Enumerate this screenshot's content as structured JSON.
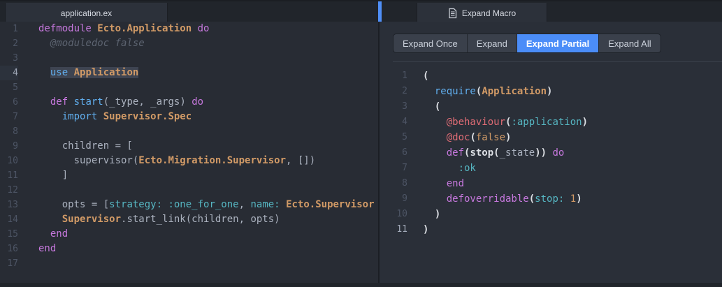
{
  "colors": {
    "accent_blue": "#4b8df8",
    "pane_accent_bar": "#4f8ff7",
    "selection": "#3e4451",
    "editor_bg": "#282c34",
    "tabbar_bg": "#21252b"
  },
  "icons": {
    "right_tab_icon": "file-text-icon"
  },
  "left_pane": {
    "tab": "application.ex",
    "lines": [
      {
        "n": 1,
        "tokens": [
          {
            "t": "defmodule",
            "c": "kw"
          },
          {
            "t": " ",
            "c": "pl"
          },
          {
            "t": "Ecto.Application",
            "c": "mod"
          },
          {
            "t": " ",
            "c": "pl"
          },
          {
            "t": "do",
            "c": "kw"
          }
        ]
      },
      {
        "n": 2,
        "tokens": [
          {
            "t": "  @moduledoc false",
            "c": "com"
          }
        ]
      },
      {
        "n": 3,
        "tokens": []
      },
      {
        "n": 4,
        "hl": true,
        "tokens": [
          {
            "t": "  ",
            "c": "pl"
          },
          {
            "t": "use",
            "c": "blue",
            "sel": true
          },
          {
            "t": " ",
            "c": "pl",
            "sel": true
          },
          {
            "t": "Application",
            "c": "mod",
            "sel": true
          }
        ]
      },
      {
        "n": 5,
        "tokens": []
      },
      {
        "n": 6,
        "tokens": [
          {
            "t": "  ",
            "c": "pl"
          },
          {
            "t": "def",
            "c": "kw"
          },
          {
            "t": " ",
            "c": "pl"
          },
          {
            "t": "start",
            "c": "blue"
          },
          {
            "t": "(_type, _args) ",
            "c": "pl"
          },
          {
            "t": "do",
            "c": "kw"
          }
        ]
      },
      {
        "n": 7,
        "tokens": [
          {
            "t": "    ",
            "c": "pl"
          },
          {
            "t": "import",
            "c": "blue"
          },
          {
            "t": " ",
            "c": "pl"
          },
          {
            "t": "Supervisor.Spec",
            "c": "mod"
          }
        ]
      },
      {
        "n": 8,
        "tokens": []
      },
      {
        "n": 9,
        "tokens": [
          {
            "t": "    children = [",
            "c": "pl"
          }
        ]
      },
      {
        "n": 10,
        "tokens": [
          {
            "t": "      supervisor(",
            "c": "pl"
          },
          {
            "t": "Ecto.Migration.Supervisor",
            "c": "mod"
          },
          {
            "t": ", [])",
            "c": "pl"
          }
        ]
      },
      {
        "n": 11,
        "tokens": [
          {
            "t": "    ]",
            "c": "pl"
          }
        ]
      },
      {
        "n": 12,
        "tokens": []
      },
      {
        "n": 13,
        "tokens": [
          {
            "t": "    opts = [",
            "c": "pl"
          },
          {
            "t": "strategy:",
            "c": "atom"
          },
          {
            "t": " ",
            "c": "pl"
          },
          {
            "t": ":one_for_one",
            "c": "atom"
          },
          {
            "t": ", ",
            "c": "pl"
          },
          {
            "t": "name:",
            "c": "atom"
          },
          {
            "t": " ",
            "c": "pl"
          },
          {
            "t": "Ecto.Supervisor",
            "c": "mod"
          }
        ]
      },
      {
        "n": 14,
        "tokens": [
          {
            "t": "    ",
            "c": "pl"
          },
          {
            "t": "Supervisor",
            "c": "mod"
          },
          {
            "t": ".start_link(children, opts)",
            "c": "pl"
          }
        ]
      },
      {
        "n": 15,
        "tokens": [
          {
            "t": "  ",
            "c": "pl"
          },
          {
            "t": "end",
            "c": "kw"
          }
        ]
      },
      {
        "n": 16,
        "tokens": [
          {
            "t": "end",
            "c": "kw"
          }
        ]
      },
      {
        "n": 17,
        "tokens": []
      }
    ]
  },
  "right_pane": {
    "tab": "Expand Macro",
    "toolbar": {
      "buttons": [
        {
          "label": "Expand Once",
          "active": false
        },
        {
          "label": "Expand",
          "active": false
        },
        {
          "label": "Expand Partial",
          "active": true
        },
        {
          "label": "Expand All",
          "active": false
        }
      ]
    },
    "lines": [
      {
        "n": 1,
        "tokens": [
          {
            "t": "(",
            "c": "pb"
          }
        ]
      },
      {
        "n": 2,
        "tokens": [
          {
            "t": "  ",
            "c": "pl"
          },
          {
            "t": "require",
            "c": "blue"
          },
          {
            "t": "(",
            "c": "pb"
          },
          {
            "t": "Application",
            "c": "mod"
          },
          {
            "t": ")",
            "c": "pb"
          }
        ]
      },
      {
        "n": 3,
        "tokens": [
          {
            "t": "  ",
            "c": "pl"
          },
          {
            "t": "(",
            "c": "pb"
          }
        ]
      },
      {
        "n": 4,
        "tokens": [
          {
            "t": "    ",
            "c": "pl"
          },
          {
            "t": "@behaviour",
            "c": "attr"
          },
          {
            "t": "(",
            "c": "pb"
          },
          {
            "t": ":application",
            "c": "atom"
          },
          {
            "t": ")",
            "c": "pb"
          }
        ]
      },
      {
        "n": 5,
        "tokens": [
          {
            "t": "    ",
            "c": "pl"
          },
          {
            "t": "@doc",
            "c": "attr"
          },
          {
            "t": "(",
            "c": "pb"
          },
          {
            "t": "false",
            "c": "num"
          },
          {
            "t": ")",
            "c": "pb"
          }
        ]
      },
      {
        "n": 6,
        "tokens": [
          {
            "t": "    ",
            "c": "pl"
          },
          {
            "t": "def",
            "c": "kw"
          },
          {
            "t": "(",
            "c": "pb"
          },
          {
            "t": "stop",
            "c": "pb"
          },
          {
            "t": "(",
            "c": "pb"
          },
          {
            "t": "_state",
            "c": "pl"
          },
          {
            "t": "))",
            "c": "pb"
          },
          {
            "t": " ",
            "c": "pl"
          },
          {
            "t": "do",
            "c": "kw"
          }
        ]
      },
      {
        "n": 7,
        "tokens": [
          {
            "t": "      ",
            "c": "pl"
          },
          {
            "t": ":ok",
            "c": "atom"
          }
        ]
      },
      {
        "n": 8,
        "tokens": [
          {
            "t": "    ",
            "c": "pl"
          },
          {
            "t": "end",
            "c": "kw"
          }
        ]
      },
      {
        "n": 9,
        "tokens": [
          {
            "t": "    ",
            "c": "pl"
          },
          {
            "t": "defoverridable",
            "c": "kw"
          },
          {
            "t": "(",
            "c": "pb"
          },
          {
            "t": "stop:",
            "c": "atom"
          },
          {
            "t": " ",
            "c": "pl"
          },
          {
            "t": "1",
            "c": "num"
          },
          {
            "t": ")",
            "c": "pb"
          }
        ]
      },
      {
        "n": 10,
        "tokens": [
          {
            "t": "  ",
            "c": "pl"
          },
          {
            "t": ")",
            "c": "pb"
          }
        ]
      },
      {
        "n": 11,
        "cur": true,
        "tokens": [
          {
            "t": ")",
            "c": "pb"
          }
        ]
      }
    ]
  }
}
